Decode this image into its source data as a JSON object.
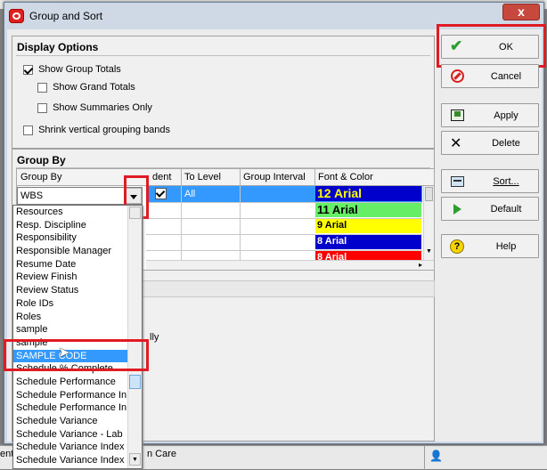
{
  "window": {
    "title": "Group and Sort",
    "close_label": "x"
  },
  "display_options": {
    "title": "Display Options",
    "show_group_totals": {
      "label": "Show Group Totals",
      "checked": true
    },
    "show_grand_totals": {
      "label": "Show Grand Totals",
      "checked": false
    },
    "show_summaries_only": {
      "label": "Show Summaries Only",
      "checked": false
    },
    "shrink_bands": {
      "label": "Shrink vertical grouping bands",
      "checked": false
    }
  },
  "group_by": {
    "title": "Group By",
    "columns": {
      "group_by": "Group By",
      "indent": "dent",
      "to_level": "To Level",
      "group_interval": "Group Interval",
      "font_color": "Font & Color"
    },
    "row1": {
      "value": "WBS",
      "to_level": "All"
    },
    "font_rows": [
      {
        "label": "12 Arial",
        "bg": "#0000cc",
        "fg": "#ffff00"
      },
      {
        "label": "11 Arial",
        "bg": "#66ee66",
        "fg": "#000000"
      },
      {
        "label": "9 Arial",
        "bg": "#ffff00",
        "fg": "#000000"
      },
      {
        "label": "8 Arial",
        "bg": "#0000cc",
        "fg": "#ffffff"
      },
      {
        "label": "8 Arial",
        "bg": "#ff0000",
        "fg": "#ffffff"
      }
    ],
    "background_text": "lly"
  },
  "dropdown": {
    "items": [
      "Resources",
      "Resp. Discipline",
      "Responsibility",
      "Responsible Manager",
      "Resume Date",
      "Review Finish",
      "Review Status",
      "Role IDs",
      "Roles",
      "sample",
      "sample",
      "SAMPLE CODE",
      "Schedule % Complete",
      "Schedule Performance",
      "Schedule Performance In",
      "Schedule Performance In",
      "Schedule Variance",
      "Schedule Variance - Lab",
      "Schedule Variance Index",
      "Schedule Variance Index"
    ],
    "selected_index": 11
  },
  "buttons": {
    "ok": "OK",
    "cancel": "Cancel",
    "apply": "Apply",
    "delete": "Delete",
    "sort": "Sort...",
    "default": "Default",
    "help": "Help"
  },
  "background": {
    "status_text": "n Care",
    "left_text": "ent"
  },
  "colors": {
    "highlight_red": "#e01b24",
    "selection_blue": "#3399ff",
    "ok_green": "#2e9e2e"
  }
}
